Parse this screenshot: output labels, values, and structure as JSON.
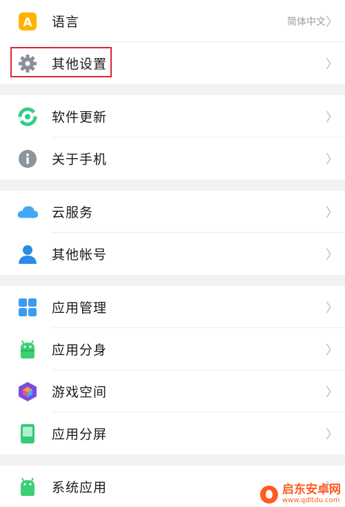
{
  "groups": [
    {
      "items": [
        {
          "label": "语言",
          "value": "简体中文",
          "icon": "language-icon"
        },
        {
          "label": "其他设置",
          "value": "",
          "icon": "gear-icon"
        }
      ]
    },
    {
      "items": [
        {
          "label": "软件更新",
          "value": "",
          "icon": "update-icon"
        },
        {
          "label": "关于手机",
          "value": "",
          "icon": "info-icon"
        }
      ]
    },
    {
      "items": [
        {
          "label": "云服务",
          "value": "",
          "icon": "cloud-icon"
        },
        {
          "label": "其他帐号",
          "value": "",
          "icon": "person-icon"
        }
      ]
    },
    {
      "items": [
        {
          "label": "应用管理",
          "value": "",
          "icon": "app-grid-icon"
        },
        {
          "label": "应用分身",
          "value": "",
          "icon": "android-clone-icon"
        },
        {
          "label": "游戏空间",
          "value": "",
          "icon": "game-cube-icon"
        },
        {
          "label": "应用分屏",
          "value": "",
          "icon": "split-screen-icon"
        }
      ]
    },
    {
      "items": [
        {
          "label": "系统应用",
          "value": "",
          "icon": "android-icon"
        }
      ]
    }
  ],
  "chevron": "〉",
  "watermark": {
    "title": "启东安卓网",
    "url": "www.qdltdu.com"
  },
  "colors": {
    "highlight": "#d9262c",
    "language": "#ffb300",
    "gear": "#8a8f99",
    "update": "#2fcf86",
    "info": "#8e949c",
    "cloud": "#3fa9f5",
    "person": "#2b8be6",
    "appgrid": "#3a9cf0",
    "android": "#3ccf73",
    "game": "#7b4ce0",
    "split": "#35c97a",
    "watermark": "#ff5a1f"
  }
}
